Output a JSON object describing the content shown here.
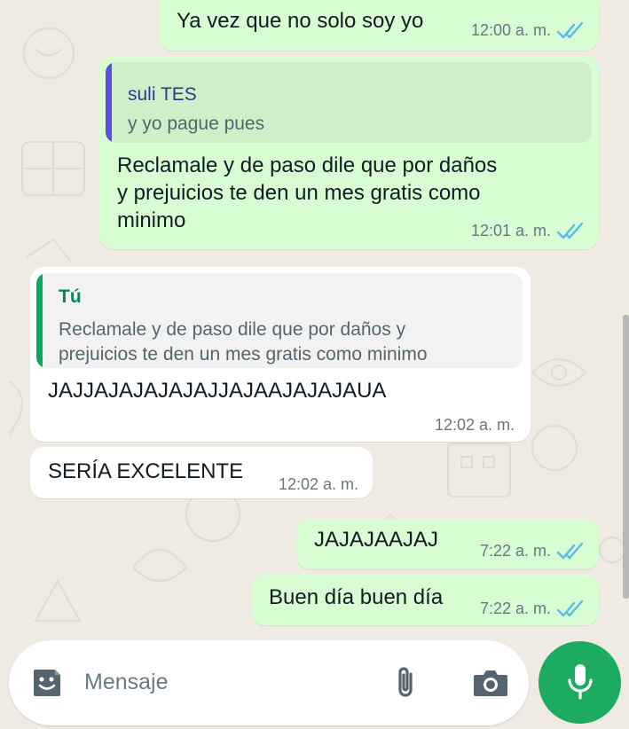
{
  "colors": {
    "outgoing_bubble": "#d9fdd3",
    "incoming_bubble": "#ffffff",
    "tick_blue": "#53bdeb",
    "accent_green": "#1daa61",
    "quote_bar_purple": "#5b4fe0",
    "quote_bar_green": "#06a95f"
  },
  "messages": [
    {
      "direction": "out",
      "text": "Ya vez que no solo soy yo",
      "time": "12:00 a. m.",
      "status": "read"
    },
    {
      "direction": "out",
      "quote_author": "suli TES",
      "quote_text": "y yo pague pues",
      "text_lines": [
        "Reclamale y de paso dile que por daños",
        "y prejuicios te den un mes gratis como",
        "minimo"
      ],
      "time": "12:01 a. m.",
      "status": "read"
    },
    {
      "direction": "in",
      "quote_author": "Tú",
      "quote_text_lines": [
        "Reclamale y de paso dile que por daños y",
        "prejuicios te den un mes gratis como minimo"
      ],
      "text": "JAJJAJAJAJAJAJJAJAAJAJAJAUA",
      "time": "12:02 a. m."
    },
    {
      "direction": "in",
      "text": "SERÍA EXCELENTE",
      "time": "12:02 a. m."
    },
    {
      "direction": "out",
      "text": "JAJAJAAJAJ",
      "time": "7:22 a. m.",
      "status": "read"
    },
    {
      "direction": "out",
      "text": "Buen día buen día",
      "time": "7:22 a. m.",
      "status": "read"
    }
  ],
  "composer": {
    "placeholder": "Mensaje",
    "icons": [
      "sticker-icon",
      "paperclip-icon",
      "camera-icon",
      "microphone-icon"
    ]
  }
}
